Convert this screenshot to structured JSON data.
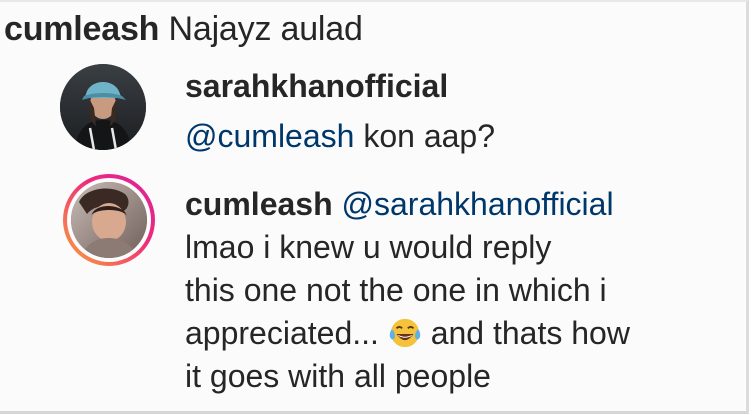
{
  "comment": {
    "username": "cumleash",
    "text": "Najayz aulad"
  },
  "replies": [
    {
      "username": "sarahkhanofficial",
      "mention": "@cumleash",
      "text": " kon aap?",
      "avatar_icon": "profile-photo"
    },
    {
      "username": "cumleash",
      "mention": "@sarahkhanofficial",
      "lines": [
        "lmao  i knew u would reply",
        "this one not the one in which i",
        "appreciated...",
        "and thats how",
        "it goes with all people"
      ],
      "emoji_icon": "face-with-tears-of-joy",
      "avatar_icon": "profile-photo-story-ring"
    }
  ],
  "colors": {
    "text": "#262626",
    "mention": "#00376b",
    "story_ring_start": "#f9a53a",
    "story_ring_end": "#d6249f"
  }
}
